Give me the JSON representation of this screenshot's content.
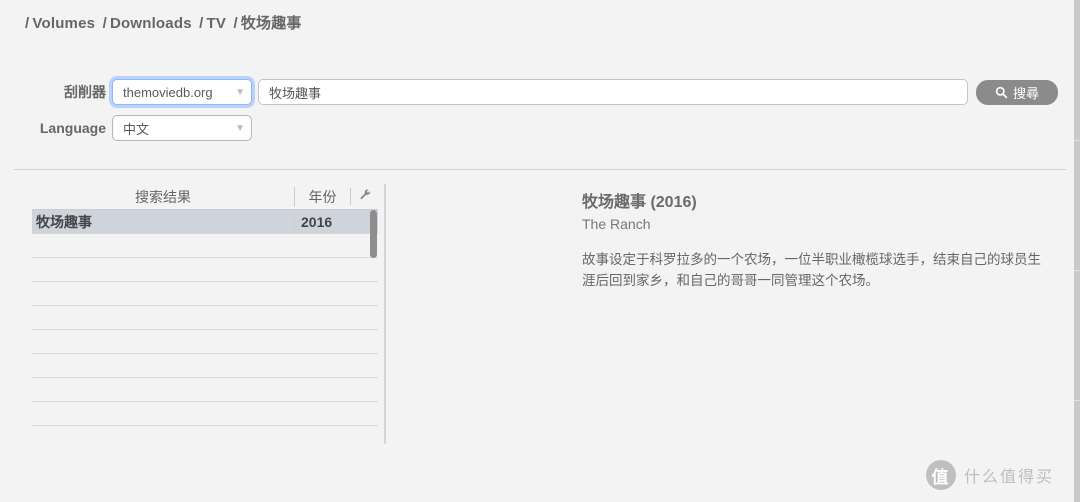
{
  "breadcrumb": {
    "parts": [
      "Volumes",
      "Downloads",
      "TV",
      "牧场趣事"
    ],
    "sep": "/"
  },
  "form": {
    "scraper_label": "刮削器",
    "scraper_value": "themoviedb.org",
    "language_label": "Language",
    "language_value": "中文",
    "search_value": "牧场趣事",
    "search_button": "搜尋"
  },
  "results": {
    "col_title": "搜索结果",
    "col_year": "年份",
    "wrench_icon": "🔧",
    "rows": [
      {
        "title": "牧场趣事",
        "year": "2016",
        "selected": true
      }
    ],
    "empty_rows": 8
  },
  "detail": {
    "title": "牧场趣事 (2016)",
    "subtitle": "The Ranch",
    "description": "故事设定于科罗拉多的一个农场，一位半职业橄榄球选手，结束自己的球员生涯后回到家乡，和自己的哥哥一同管理这个农场。"
  },
  "watermark": {
    "badge": "值",
    "text": "什么值得买"
  }
}
